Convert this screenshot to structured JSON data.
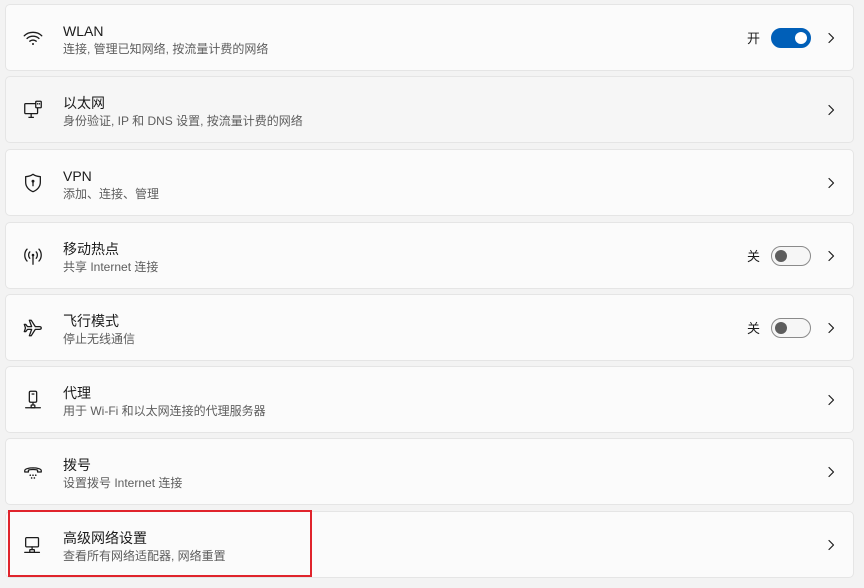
{
  "items": [
    {
      "title": "WLAN",
      "subtitle": "连接, 管理已知网络, 按流量计费的网络",
      "icon": "wifi-icon",
      "toggle_label": "开",
      "toggle_state": "on"
    },
    {
      "title": "以太网",
      "subtitle": "身份验证, IP 和 DNS 设置, 按流量计费的网络",
      "icon": "ethernet-icon"
    },
    {
      "title": "VPN",
      "subtitle": "添加、连接、管理",
      "icon": "vpn-shield-icon"
    },
    {
      "title": "移动热点",
      "subtitle": "共享 Internet 连接",
      "icon": "hotspot-icon",
      "toggle_label": "关",
      "toggle_state": "off"
    },
    {
      "title": "飞行模式",
      "subtitle": "停止无线通信",
      "icon": "airplane-icon",
      "toggle_label": "关",
      "toggle_state": "off"
    },
    {
      "title": "代理",
      "subtitle": "用于 Wi-Fi 和以太网连接的代理服务器",
      "icon": "proxy-icon"
    },
    {
      "title": "拨号",
      "subtitle": "设置拨号 Internet 连接",
      "icon": "dialup-icon"
    },
    {
      "title": "高级网络设置",
      "subtitle": "查看所有网络适配器, 网络重置",
      "icon": "advanced-network-icon"
    }
  ],
  "colors": {
    "accent": "#005fb8",
    "highlight": "#e0242c"
  }
}
